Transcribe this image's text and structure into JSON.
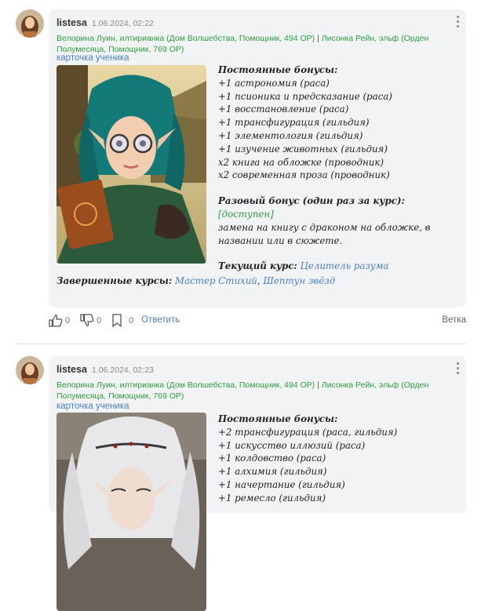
{
  "posts": [
    {
      "author": "listesa",
      "date": "1.06.2024, 02:22",
      "char1": "Велорина Луин, илтирианка (Дом Волшебства, Помощник, 494 ОР)",
      "separator": "|",
      "char2": "Лисонка Рейн, эльф (Орден Полумесяца, Помощник, 769 ОР)",
      "student_card_link": "карточка ученика",
      "permanent_header": "Постоянные бонусы:",
      "bonuses": [
        "+1 астрономия (раса)",
        "+1 псионика и предсказание (раса)",
        "+1 восстановление (раса)",
        "+1 трансфигурация (гильдия)",
        "+1 элементология (гильдия)",
        "+1 изучение животных (гильдия)",
        "x2 книга на обложке (проводник)",
        "x2 современная проза (проводник)"
      ],
      "onetime_header": "Разовый бонус (один раз за курс):",
      "onetime_status": "[доступен]",
      "onetime_text_1": "замена на книгу с драконом на обложке, в",
      "onetime_text_2": "названии или в сюжете.",
      "current_header": "Текущий курс:",
      "current_course": "Целитель разума",
      "completed_header": "Завершенные курсы:",
      "completed_1": "Мастер Стихий",
      "completed_sep": ",",
      "completed_2": "Шептун звёзд",
      "likes": "0",
      "dislikes": "0",
      "bookmarks": "0",
      "reply_label": "Ответить",
      "thread_label": "Ветка"
    },
    {
      "author": "listesa",
      "date": "1.06.2024, 02:23",
      "char1": "Велорина Луин, илтирианка (Дом Волшебства, Помощник, 494 ОР)",
      "separator": "|",
      "char2": "Лисонка Рейн, эльф (Орден Полумесяца, Помощник, 769 ОР)",
      "student_card_link": "карточка ученика",
      "permanent_header": "Постоянные бонусы:",
      "bonuses": [
        "+2 трансфигурация (раса, гильдия)",
        "+1 искусство иллюзий (раса)",
        "+1 колдовство (раса)",
        "+1 алхимия (гильдия)",
        "+1 начертание (гильдия)",
        "+1 ремесло (гильдия)"
      ]
    }
  ],
  "colors": {
    "card_bg": "#f2f3f5",
    "character_green": "#2e9e3e",
    "link_blue": "#4a7fc1"
  }
}
